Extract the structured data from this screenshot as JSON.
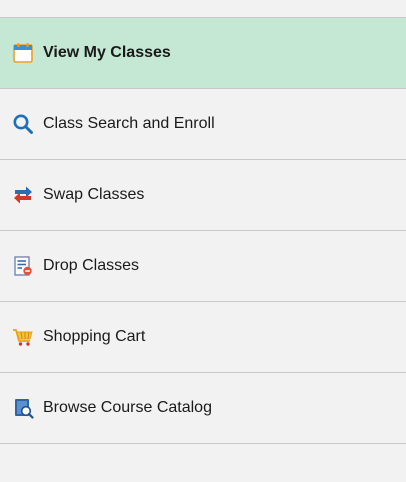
{
  "sidebar": {
    "selected_index": 0,
    "items": [
      {
        "label": "View My Classes",
        "icon": "calendar-icon"
      },
      {
        "label": "Class Search and Enroll",
        "icon": "search-icon"
      },
      {
        "label": "Swap Classes",
        "icon": "swap-arrows-icon"
      },
      {
        "label": "Drop Classes",
        "icon": "drop-document-icon"
      },
      {
        "label": "Shopping Cart",
        "icon": "shopping-cart-icon"
      },
      {
        "label": "Browse Course Catalog",
        "icon": "catalog-book-icon"
      }
    ]
  },
  "colors": {
    "selected_background": "#c5e8d4",
    "search_blue": "#1f6fb8",
    "swap_red": "#d03a2a",
    "swap_blue": "#2a6db3",
    "cart_orange": "#e8a317",
    "calendar_orange": "#f0a020"
  }
}
